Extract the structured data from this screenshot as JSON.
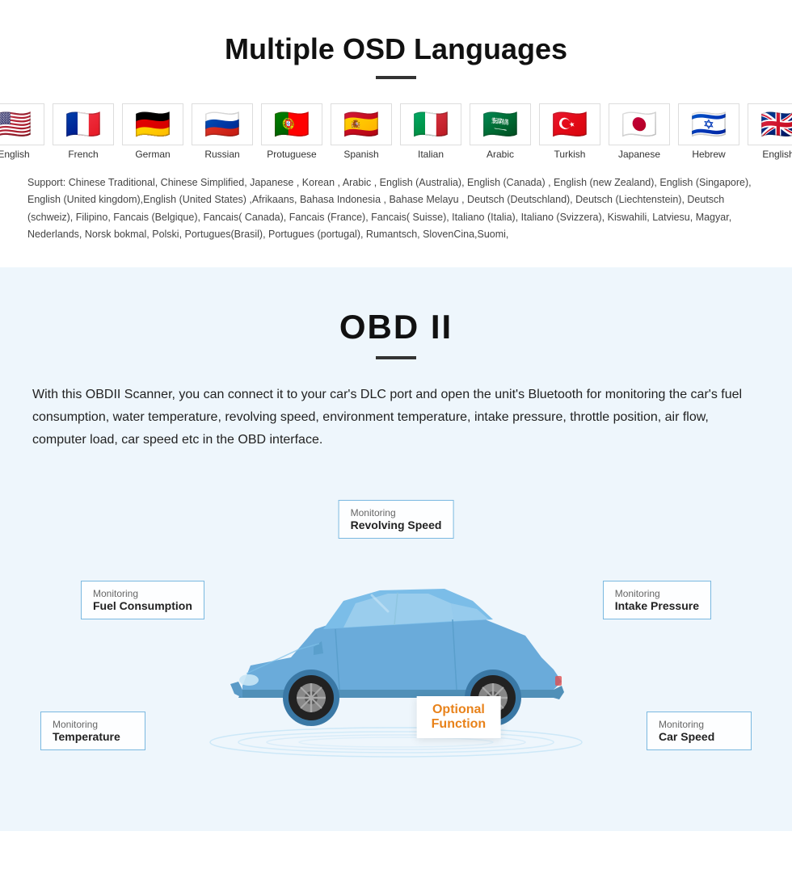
{
  "languages_section": {
    "title": "Multiple OSD Languages",
    "flags": [
      {
        "emoji": "🇺🇸",
        "label": "English"
      },
      {
        "emoji": "🇫🇷",
        "label": "French"
      },
      {
        "emoji": "🇩🇪",
        "label": "German"
      },
      {
        "emoji": "🇷🇺",
        "label": "Russian"
      },
      {
        "emoji": "🇵🇹",
        "label": "Protuguese"
      },
      {
        "emoji": "🇪🇸",
        "label": "Spanish"
      },
      {
        "emoji": "🇮🇹",
        "label": "Italian"
      },
      {
        "emoji": "🇸🇦",
        "label": "Arabic"
      },
      {
        "emoji": "🇹🇷",
        "label": "Turkish"
      },
      {
        "emoji": "🇯🇵",
        "label": "Japanese"
      },
      {
        "emoji": "🇮🇱",
        "label": "Hebrew"
      },
      {
        "emoji": "🇬🇧",
        "label": "English"
      }
    ],
    "support_text": "Support: Chinese Traditional, Chinese Simplified, Japanese , Korean , Arabic , English (Australia), English (Canada) , English (new Zealand), English (Singapore), English (United kingdom),English (United States) ,Afrikaans, Bahasa Indonesia , Bahase Melayu , Deutsch (Deutschland), Deutsch (Liechtenstein), Deutsch (schweiz), Filipino, Fancais (Belgique), Fancais( Canada), Fancais (France), Fancais( Suisse), Italiano (Italia), Italiano (Svizzera), Kiswahili, Latviesu, Magyar, Nederlands, Norsk bokmal, Polski, Portugues(Brasil), Portugues (portugal), Rumantsch, SlovenCina,Suomi,"
  },
  "obd_section": {
    "title": "OBD II",
    "description": "With this OBDII Scanner, you can connect it to your car's DLC port and open the unit's Bluetooth for monitoring the car's fuel consumption, water temperature, revolving speed, environment temperature, intake pressure, throttle position, air flow, computer load, car speed etc in the OBD interface.",
    "monitors": {
      "revolving": {
        "sub": "Monitoring",
        "main": "Revolving Speed"
      },
      "fuel": {
        "sub": "Monitoring",
        "main": "Fuel Consumption"
      },
      "intake": {
        "sub": "Monitoring",
        "main": "Intake Pressure"
      },
      "temperature": {
        "sub": "Monitoring",
        "main": "Temperature"
      },
      "carspeed": {
        "sub": "Monitoring",
        "main": "Car Speed"
      }
    },
    "optional": {
      "line1": "Optional",
      "line2": "Function"
    }
  }
}
